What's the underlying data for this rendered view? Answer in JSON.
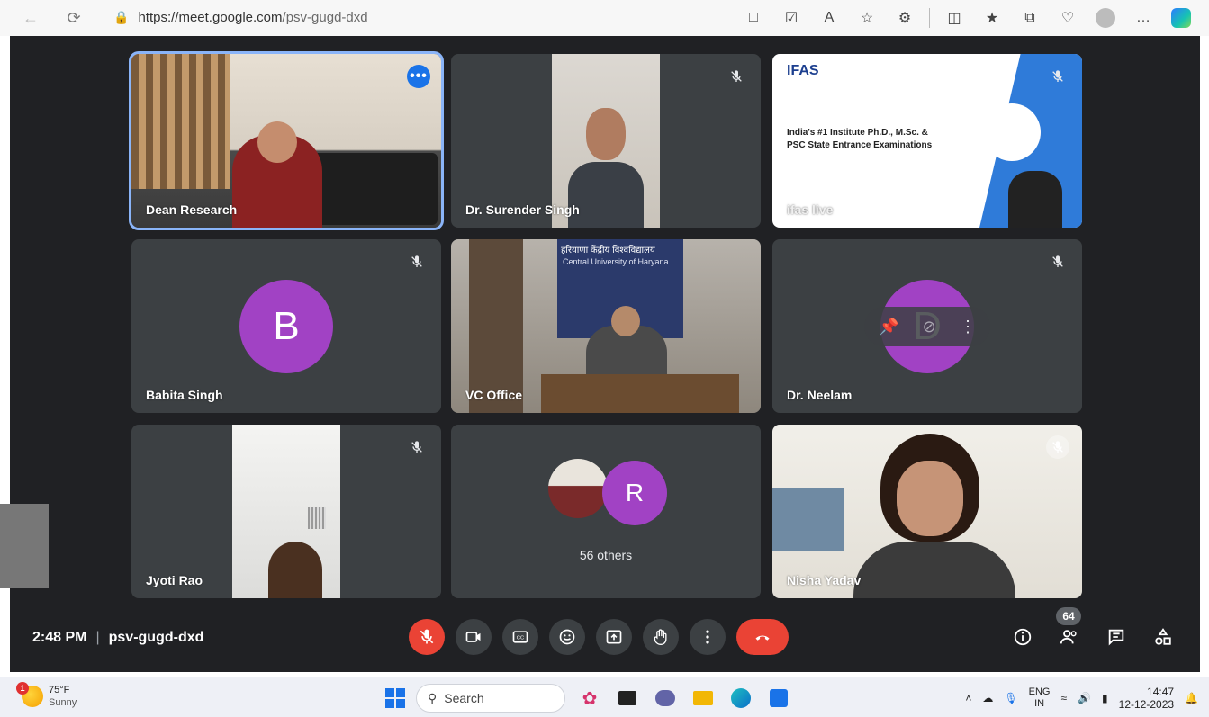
{
  "browser": {
    "url_host": "https://meet.google.com",
    "url_path": "/psv-gugd-dxd"
  },
  "tiles": [
    {
      "name": "Dean Research",
      "type": "video",
      "active": true
    },
    {
      "name": "Dr. Surender Singh",
      "type": "video",
      "muted": true
    },
    {
      "name": "ifas live",
      "type": "presentation",
      "muted": true,
      "slide_brand": "IFAS",
      "slide_text_1": "India's #1 Institute Ph.D., M.Sc. &",
      "slide_text_2": "PSC State Entrance Examinations"
    },
    {
      "name": "Babita Singh",
      "type": "avatar",
      "initial": "B",
      "muted": true
    },
    {
      "name": "VC Office",
      "type": "video",
      "banner_hindi": "हरियाणा केंद्रीय विश्वविद्यालय",
      "banner_en": "Central University of Haryana"
    },
    {
      "name": "Dr. Neelam",
      "type": "avatar",
      "initial": "D",
      "muted": true
    },
    {
      "name": "Jyoti Rao",
      "type": "video",
      "muted": true
    },
    {
      "name": "56 others",
      "type": "group",
      "initial": "R"
    },
    {
      "name": "Nisha Yadav",
      "type": "video",
      "muted": true
    }
  ],
  "meeting": {
    "time": "2:48 PM",
    "separator": "|",
    "code": "psv-gugd-dxd",
    "participants_count": "64"
  },
  "taskbar": {
    "weather_temp": "75°F",
    "weather_condition": "Sunny",
    "weather_badge": "1",
    "search_placeholder": "Search",
    "lang_top": "ENG",
    "lang_bottom": "IN",
    "clock_time": "14:47",
    "clock_date": "12-12-2023"
  },
  "colors": {
    "meet_bg": "#202124",
    "tile_bg": "#3c4043",
    "avatar_purple": "#a142c4",
    "danger_red": "#ea4335",
    "active_outline": "#8ab4f8"
  }
}
